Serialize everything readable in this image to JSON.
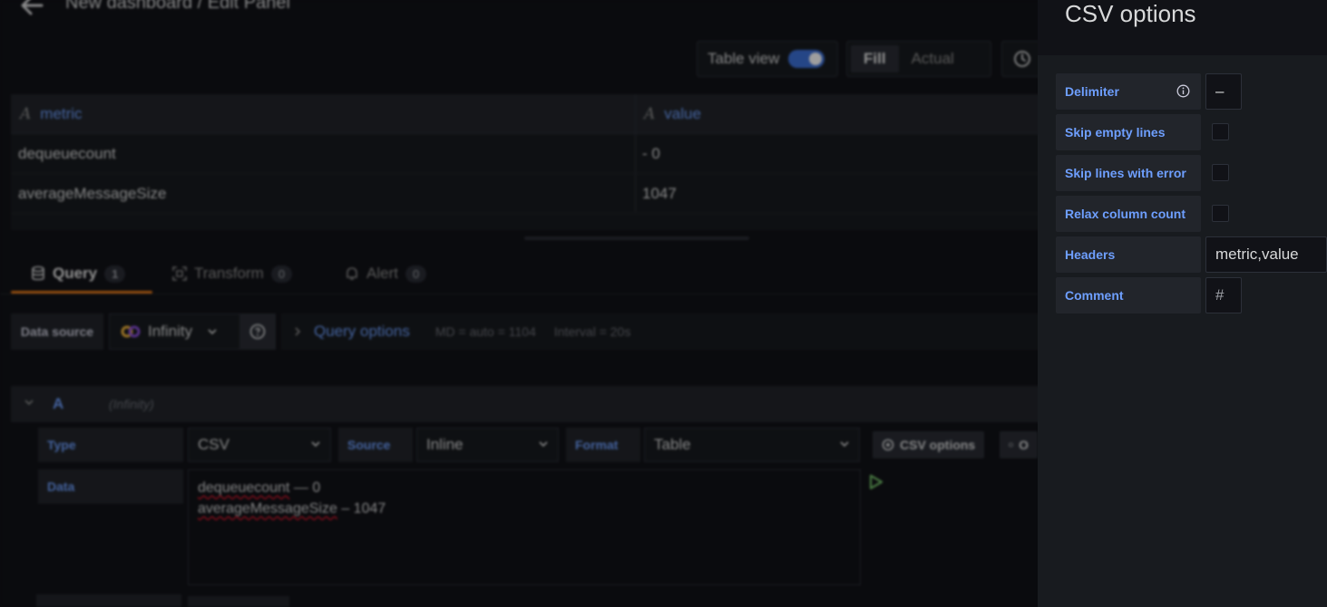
{
  "header": {
    "title": "New dashboard / Edit Panel"
  },
  "toolbar": {
    "table_view_label": "Table view",
    "table_view_on": true,
    "fill_label": "Fill",
    "actual_label": "Actual"
  },
  "table": {
    "columns": [
      "metric",
      "value"
    ],
    "type_glyph": "A",
    "rows": [
      [
        "dequeuecount",
        "- 0"
      ],
      [
        "averageMessageSize",
        "1047"
      ]
    ]
  },
  "tabs": [
    {
      "label": "Query",
      "count": "1",
      "icon": "database-icon"
    },
    {
      "label": "Transform",
      "count": "0",
      "icon": "transform-icon"
    },
    {
      "label": "Alert",
      "count": "0",
      "icon": "bell-icon"
    }
  ],
  "datasource": {
    "label": "Data source",
    "value": "Infinity",
    "query_options_label": "Query options",
    "md": "MD = auto = 1104",
    "interval": "Interval = 20s"
  },
  "query": {
    "ref_id": "A",
    "datasource_name": "(Infinity)",
    "type_label": "Type",
    "type_value": "CSV",
    "source_label": "Source",
    "source_value": "Inline",
    "format_label": "Format",
    "format_value": "Table",
    "csv_options_btn": "CSV options",
    "other_btn": "O",
    "data_label": "Data",
    "data_lines": [
      {
        "key": "dequeuecount",
        "rest": " — 0"
      },
      {
        "key": "averageMessageSize",
        "rest": " – 1047"
      }
    ]
  },
  "drawer": {
    "title": "CSV options",
    "delimiter_label": "Delimiter",
    "delimiter_value": "–",
    "skip_empty_label": "Skip empty lines",
    "skip_error_label": "Skip lines with error",
    "relax_label": "Relax column count",
    "headers_label": "Headers",
    "headers_value": "metric,value",
    "comment_label": "Comment",
    "comment_value": "#"
  },
  "colors": {
    "accent_blue": "#6e9fff",
    "tab_underline": "#eb7b18",
    "run_green": "#73bf69",
    "error_squiggle": "#c4162a"
  }
}
